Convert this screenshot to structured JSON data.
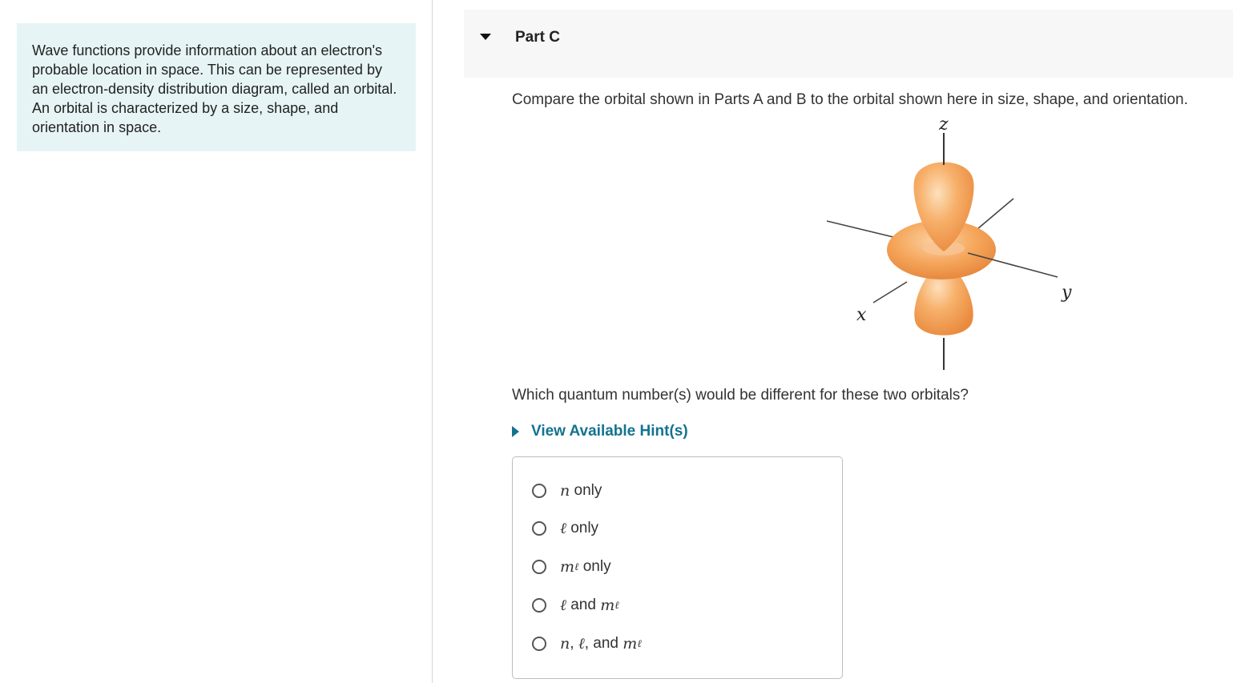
{
  "intro": {
    "text": "Wave functions provide information about an electron's probable location in space. This can be represented by an electron-density distribution diagram, called an orbital. An orbital is characterized by a size, shape, and orientation in space."
  },
  "part": {
    "title": "Part C",
    "question": "Compare the orbital shown in Parts A and B to the orbital shown here in size, shape, and orientation.",
    "sub_question": "Which quantum number(s) would be different for these two orbitals?",
    "hints_label": "View Available Hint(s)"
  },
  "figure": {
    "axis_x": "x",
    "axis_y": "y",
    "axis_z": "z",
    "lobe_color": "#f5a55a",
    "torus_color": "#f39a4c"
  },
  "options": {
    "opt1": {
      "text": "only",
      "n": "n"
    },
    "opt2": {
      "text": "only",
      "l": "ℓ"
    },
    "opt3": {
      "text": "only",
      "m": "m",
      "sub": "ℓ"
    },
    "opt4": {
      "l": "ℓ",
      "and": "and",
      "m": "m",
      "sub": "ℓ"
    },
    "opt5": {
      "n": "n",
      "comma1": ",",
      "l": "ℓ",
      "comma2": ", and",
      "m": "m",
      "sub": "ℓ"
    }
  }
}
